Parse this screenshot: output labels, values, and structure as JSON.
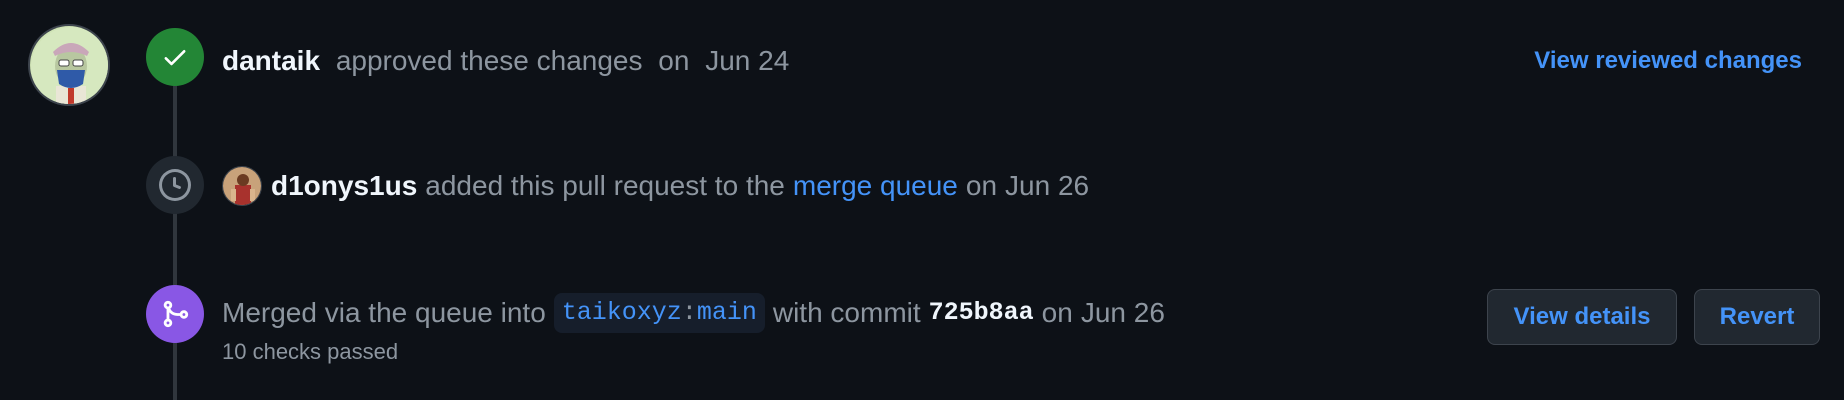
{
  "timeline": {
    "approved": {
      "user": "dantaik",
      "text": "approved these changes",
      "date_prefix": "on",
      "date": "Jun 24",
      "action_link": "View reviewed changes",
      "badge_color": "#238636"
    },
    "merge_queue": {
      "user": "d1onys1us",
      "text": "added this pull request to the",
      "link": "merge queue",
      "date_prefix": "on",
      "date": "Jun 26"
    },
    "merged": {
      "text": "Merged via the queue into",
      "repo": "taikoxyz",
      "separator": ":",
      "branch": "main",
      "with_commit": "with commit",
      "commit": "725b8aa",
      "date_prefix": "on",
      "date": "Jun 26",
      "checks": "10 checks passed",
      "view_details_label": "View details",
      "revert_label": "Revert",
      "badge_color": "#8957e5"
    }
  },
  "colors": {
    "background": "#0d1117",
    "link": "#4493f8",
    "muted": "#8d96a0",
    "emphasis": "#f0f6fc"
  },
  "icons": {
    "approved": "check-icon",
    "queue": "clock-icon",
    "merged": "git-merge-icon"
  }
}
